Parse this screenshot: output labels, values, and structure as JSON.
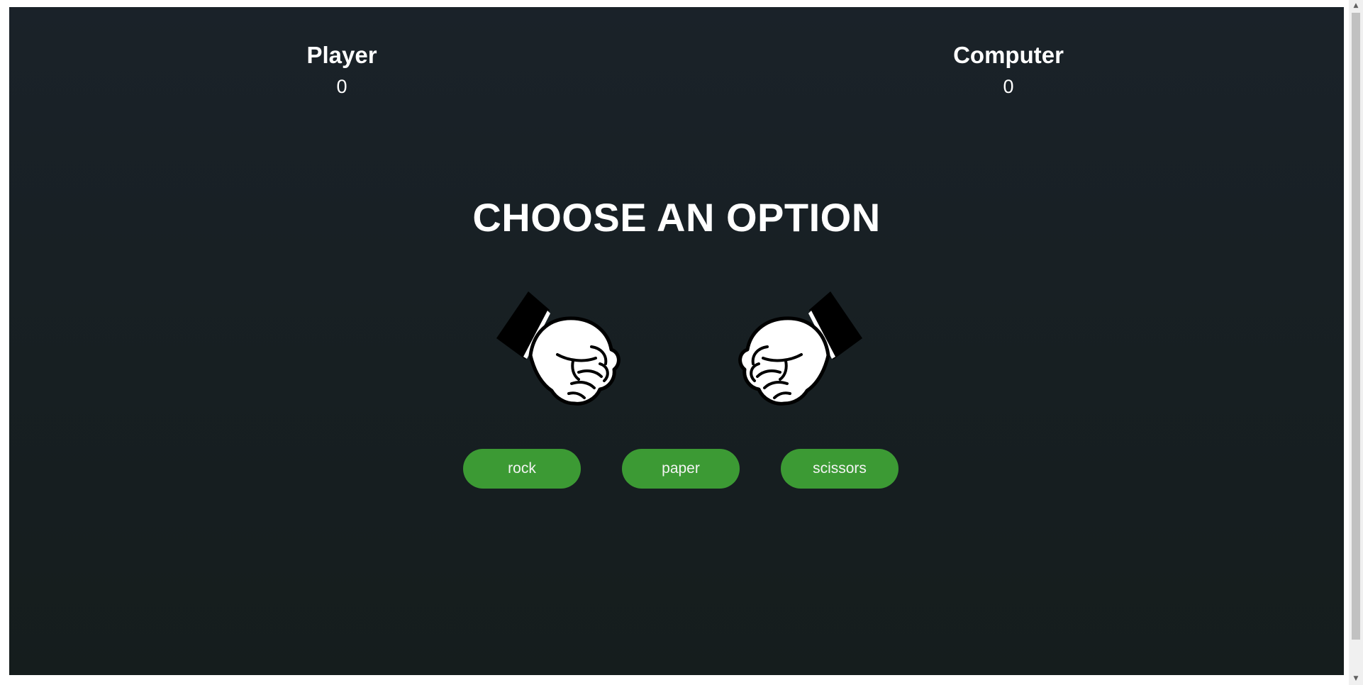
{
  "scoreboard": {
    "player": {
      "label": "Player",
      "score": "0"
    },
    "computer": {
      "label": "Computer",
      "score": "0"
    }
  },
  "prompt": "CHOOSE AN OPTION",
  "hands": {
    "player_hand": "fist-hand-icon",
    "computer_hand": "fist-hand-icon"
  },
  "options": [
    {
      "label": "rock"
    },
    {
      "label": "paper"
    },
    {
      "label": "scissors"
    }
  ],
  "colors": {
    "background": "#182024",
    "button": "#3c9a34",
    "text": "#ffffff"
  }
}
